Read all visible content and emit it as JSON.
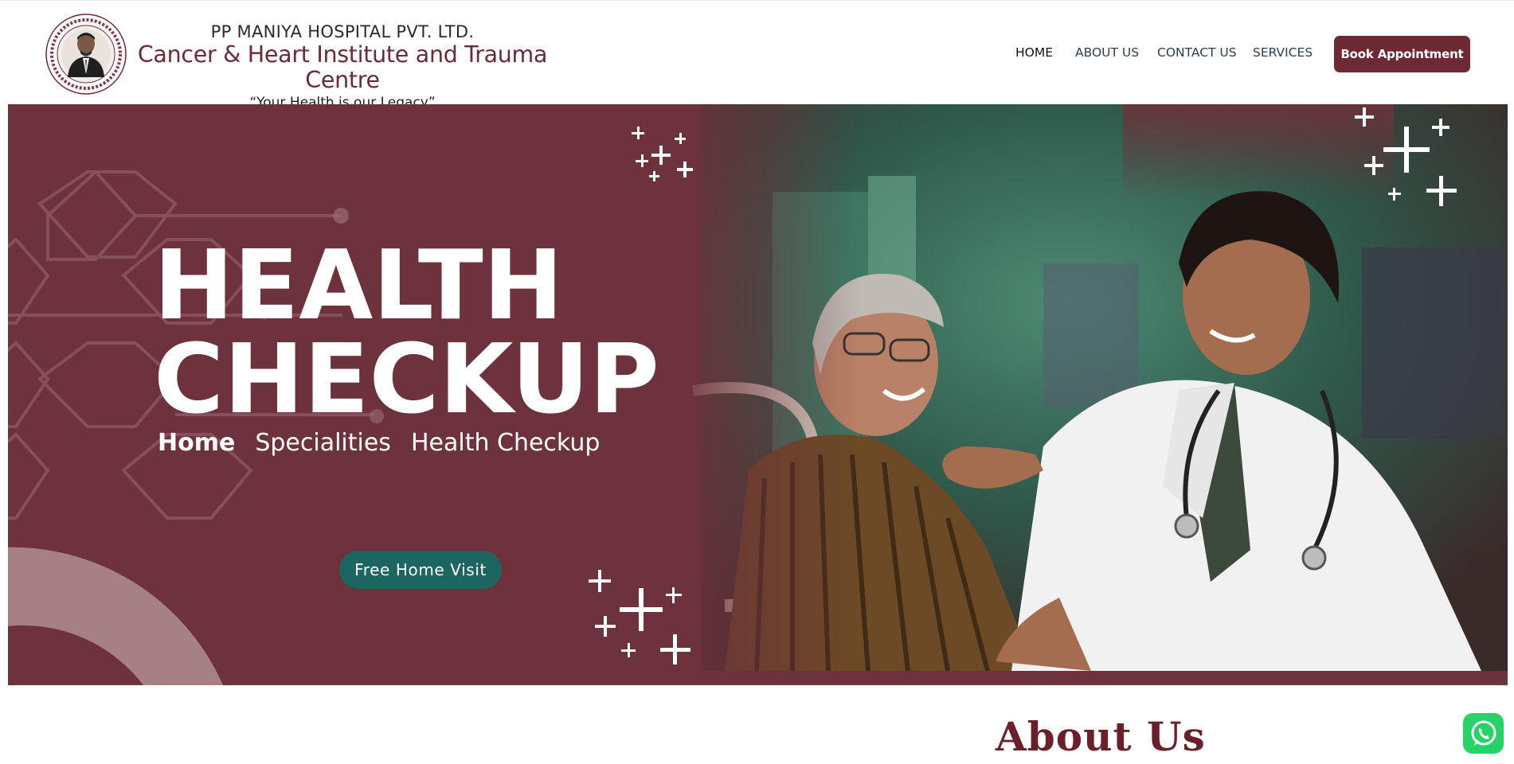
{
  "brand": {
    "logo_icon": "hospital-founder-seal",
    "company": "PP MANIYA HOSPITAL PVT. LTD.",
    "institute": "Cancer & Heart Institute and Trauma Centre",
    "tagline": "“Your Health is our Legacy”"
  },
  "nav": {
    "items": [
      {
        "label": "HOME",
        "active": true
      },
      {
        "label": "ABOUT US",
        "active": false
      },
      {
        "label": "CONTACT US",
        "active": false
      },
      {
        "label": "SERVICES",
        "active": false
      }
    ],
    "cta_label": "Book Appointment"
  },
  "hero": {
    "title_line1": "HEALTH",
    "title_line2": "CHECKUP",
    "breadcrumb": [
      "Home",
      "Specialities",
      "Health Checkup"
    ],
    "button_label": "Free Home Visit",
    "image_icon": "doctor-with-patient-photo",
    "decor_icons": [
      "sparkle-plus-icon",
      "hexagon-pattern",
      "ring-arc"
    ]
  },
  "about": {
    "title": "About Us"
  },
  "floating": {
    "whatsapp_icon": "whatsapp-icon"
  },
  "colors": {
    "brand_maroon": "#6e2a34",
    "hero_bg": "#6d323b",
    "button_teal": "#1c6560",
    "nav_text": "#2c3e50",
    "about_title": "#6b1f28",
    "whatsapp_green": "#25d366"
  }
}
